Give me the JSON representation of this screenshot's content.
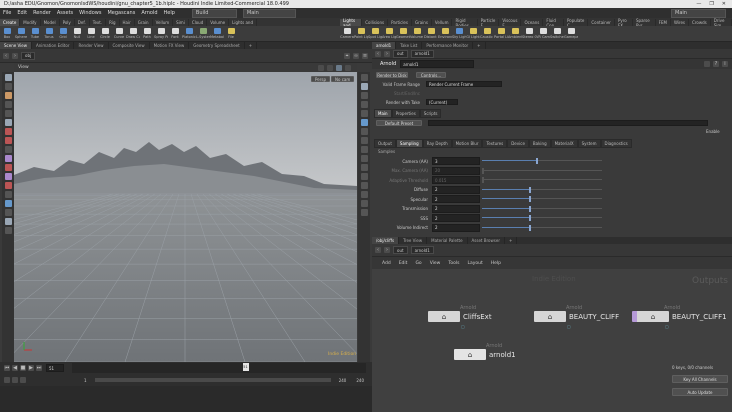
{
  "window": {
    "title": "D:/asha EDU/Gnomon/GnomonIsdWS/houdini/gnu_chapter5_1b.hiplc - Houdini Indie Limited-Commercial 18.0.499",
    "controls": [
      "—",
      "❐",
      "✕"
    ]
  },
  "menu": [
    "File",
    "Edit",
    "Render",
    "Assets",
    "Windows",
    "Megascans",
    "Arnold",
    "Help"
  ],
  "build_menu": "Build",
  "desktop_menu": "Main",
  "shelf_tabs": [
    "Create",
    "Modify",
    "Model",
    "Poly",
    "Def.",
    "Text.",
    "Rig",
    "Hair",
    "Grain",
    "Vellum",
    "Simi",
    "Cloud",
    "Volume",
    "Lights and"
  ],
  "shelf_tools": [
    {
      "label": "Box",
      "c": "b"
    },
    {
      "label": "Sphere",
      "c": "b"
    },
    {
      "label": "Tube",
      "c": "b"
    },
    {
      "label": "Torus",
      "c": "b"
    },
    {
      "label": "Grid",
      "c": "b"
    },
    {
      "label": "Null",
      "c": "w"
    },
    {
      "label": "Line",
      "c": "w"
    },
    {
      "label": "Circle",
      "c": "w"
    },
    {
      "label": "Curve",
      "c": "w"
    },
    {
      "label": "Draw Curve",
      "c": "w"
    },
    {
      "label": "Path",
      "c": "w"
    },
    {
      "label": "Spray Paint",
      "c": "w"
    },
    {
      "label": "Font",
      "c": "w"
    },
    {
      "label": "Platonic Solids",
      "c": "b"
    },
    {
      "label": "L-System",
      "c": "g"
    },
    {
      "label": "Metaball",
      "c": "b"
    },
    {
      "label": "File",
      "c": "y"
    }
  ],
  "light_tabs": [
    "Lights and",
    "Collisions",
    "Particles",
    "Grains",
    "Vellum",
    "Rigid Bodies",
    "Particle F",
    "Viscous F",
    "Oceans",
    "Fluid Con",
    "Populate C",
    "Container",
    "Pyro FX",
    "Sparse Pyr",
    "FEM",
    "Wires",
    "Crowds",
    "Drive Sim"
  ],
  "light_tools": [
    {
      "label": "Camera",
      "c": "w"
    },
    {
      "label": "Point Light",
      "c": "y"
    },
    {
      "label": "Spot Light",
      "c": "y"
    },
    {
      "label": "Area Light",
      "c": "y"
    },
    {
      "label": "Geometry Light",
      "c": "y"
    },
    {
      "label": "Volume Light",
      "c": "y"
    },
    {
      "label": "Distant Light",
      "c": "y"
    },
    {
      "label": "Environment Light",
      "c": "y"
    },
    {
      "label": "Sky Light",
      "c": "b"
    },
    {
      "label": "GI Light",
      "c": "y"
    },
    {
      "label": "Caustic Light",
      "c": "y"
    },
    {
      "label": "Portal Light",
      "c": "y"
    },
    {
      "label": "Ambient Light",
      "c": "y"
    },
    {
      "label": "Stereo Camera",
      "c": "w"
    },
    {
      "label": "VR Camera",
      "c": "w"
    },
    {
      "label": "Switcher",
      "c": "w"
    },
    {
      "label": "Gamepad Camera",
      "c": "w"
    }
  ],
  "left_pane_tabs": [
    "Scene View",
    "Animation Editor",
    "Render View",
    "Composite View",
    "Motion FX View",
    "Geometry Spreadsheet"
  ],
  "left_path": "obj",
  "viewport": {
    "label": "View",
    "persp": "Persp",
    "cam": "No cam",
    "watermark": "Indie Edition"
  },
  "timeline": {
    "frame": "51",
    "start": "1",
    "end_a": "240",
    "end_b": "240",
    "marker": "51"
  },
  "right_pane_tabs": [
    "arnold1",
    "Take List",
    "Performance Monitor"
  ],
  "right_path": "out",
  "params": {
    "node_type": "Arnold",
    "node_name": "arnold1",
    "render_to_disk": "Render to Disk",
    "controls": "Controls...",
    "valid_frame_range_label": "Valid Frame Range",
    "valid_frame_range_value": "Render Current Frame",
    "start_end_label": "Start/End/Inc",
    "render_with_take_label": "Render with Take",
    "render_with_take_value": "(Current)",
    "tabs": [
      "Main",
      "Properties",
      "Scripts"
    ],
    "default_preset": "Default Preset",
    "enable": "Enable",
    "sub_tabs": [
      "Output",
      "Sampling",
      "Ray Depth",
      "Motion Blur",
      "Textures",
      "Device",
      "Baking",
      "MaterialX",
      "System",
      "Diagnostics"
    ],
    "section": "Samples",
    "rows": [
      {
        "label": "Camera (AA)",
        "value": "3",
        "fraction": 0.45,
        "dim": false
      },
      {
        "label": "Max. Camera (AA)",
        "value": "20",
        "fraction": 0.0,
        "dim": true
      },
      {
        "label": "Adaptive Threshold",
        "value": "0.015",
        "fraction": 0.0,
        "dim": true
      },
      {
        "label": "Diffuse",
        "value": "2",
        "fraction": 0.39,
        "dim": false
      },
      {
        "label": "Specular",
        "value": "2",
        "fraction": 0.39,
        "dim": false
      },
      {
        "label": "Transmission",
        "value": "2",
        "fraction": 0.39,
        "dim": false
      },
      {
        "label": "SSS",
        "value": "2",
        "fraction": 0.39,
        "dim": false
      },
      {
        "label": "Volume Indirect",
        "value": "2",
        "fraction": 0.39,
        "dim": false
      }
    ]
  },
  "net_pane_tabs": [
    "/obj/cliffs",
    "Tree View",
    "Material Palette",
    "Asset Browser"
  ],
  "net_path": "out",
  "net_menu": [
    "Add",
    "Edit",
    "Go",
    "View",
    "Tools",
    "Layout",
    "Help"
  ],
  "net_watermark": "Indie Edition",
  "net_context": "Outputs",
  "nodes": [
    {
      "type": "Arnold",
      "name": "CliffsExt",
      "variant": "normal"
    },
    {
      "type": "Arnold",
      "name": "BEAUTY_CLIFF",
      "variant": "normal"
    },
    {
      "type": "Arnold",
      "name": "BEAUTY_CLIFF1",
      "variant": "purple"
    },
    {
      "type": "Arnold",
      "name": "arnold1",
      "variant": "sel"
    }
  ],
  "status": {
    "keys": "0 keys, 0/0 channels",
    "keys_channels": "Key All Channels",
    "auto_update": "Auto Update"
  }
}
